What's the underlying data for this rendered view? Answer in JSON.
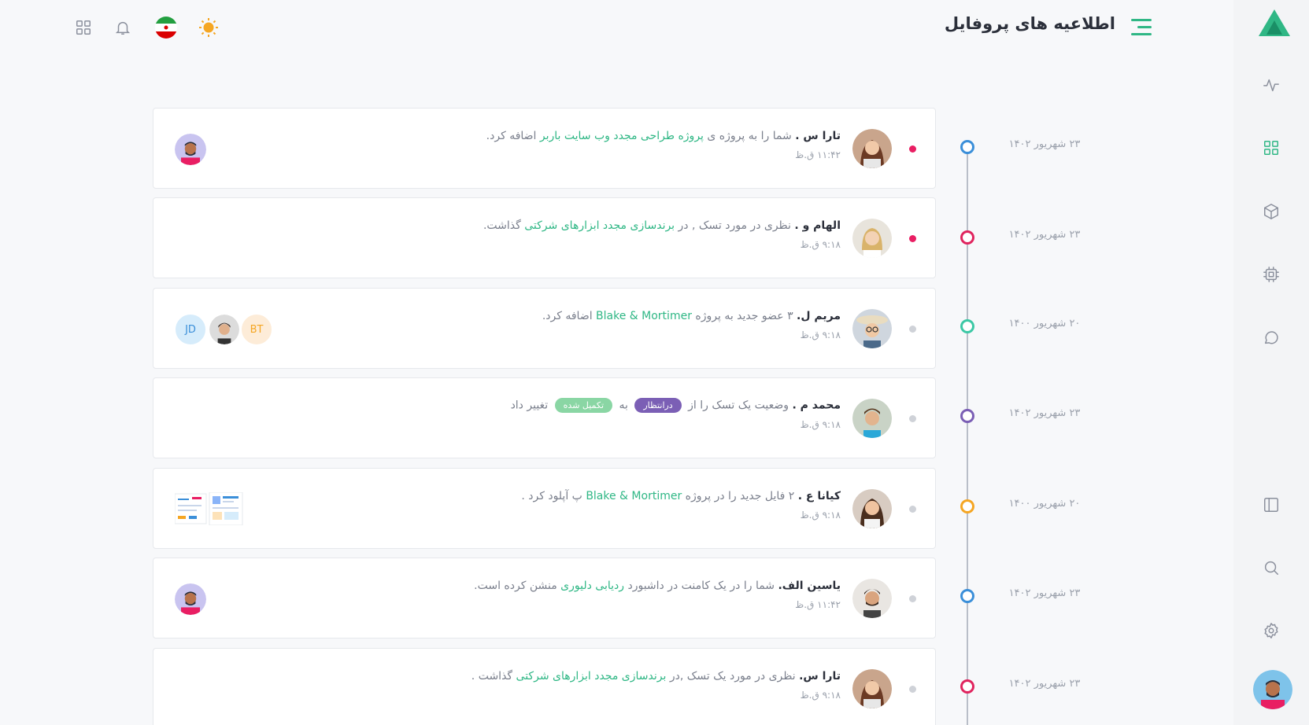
{
  "header": {
    "title": "اطلاعیه های پروفایل",
    "flag": "iran-flag-icon"
  },
  "colors": {
    "accent": "#2fb785",
    "unread": "#e91e63",
    "blue": "#3b8fd9",
    "red": "#e0245e",
    "teal": "#3cc8a5",
    "purple": "#7b5fb5",
    "orange": "#f5a623"
  },
  "sidebar": {
    "items": [
      {
        "icon": "activity-icon"
      },
      {
        "icon": "dashboard-grid-icon",
        "active": true
      },
      {
        "icon": "cube-icon"
      },
      {
        "icon": "cpu-chip-icon"
      },
      {
        "icon": "chat-bubble-icon"
      },
      {
        "icon": "layout-panel-icon"
      },
      {
        "icon": "search-icon"
      },
      {
        "icon": "settings-gear-icon"
      }
    ]
  },
  "timeline": [
    {
      "date": "۲۳ شهریور ۱۴۰۲",
      "dot_color": "#3b8fd9",
      "unread": true,
      "name": "تارا س .",
      "text_plain": " شما را به پروژه ی ",
      "text_link": "پروژه طراحی مجدد وب سایت باربر",
      "text_after": " اضافه کرد.",
      "time": "۱۱:۴۲ ق.ظ"
    },
    {
      "date": "۲۳ شهریور ۱۴۰۲",
      "dot_color": "#e0245e",
      "unread": true,
      "name": "الهام و .",
      "text_plain": " نظری در مورد تسک , در ",
      "text_link": "برندسازی مجدد ابزارهای شرکتی",
      "text_after": " گذاشت.",
      "time": "۹:۱۸ ق.ظ"
    },
    {
      "date": "۲۰ شهریور ۱۴۰۰",
      "dot_color": "#3cc8a5",
      "unread": false,
      "name": "مریم ل.",
      "text_plain": " ۳ عضو جدید به پروژه ",
      "text_link": "Blake & Mortimer",
      "text_after": " اضافه کرد.",
      "time": "۹:۱۸ ق.ظ",
      "initials": [
        "JD",
        "BT"
      ]
    },
    {
      "date": "۲۳ شهریور ۱۴۰۲",
      "dot_color": "#7b5fb5",
      "unread": false,
      "name": "محمد م .",
      "text_plain": " وضعیت یک تسک را از ",
      "badge_from": "درانتظار",
      "text_mid": " به ",
      "badge_to": "تکمیل شده",
      "text_after": " تغییر داد",
      "time": "۹:۱۸ ق.ظ"
    },
    {
      "date": "۲۰ شهریور ۱۴۰۰",
      "dot_color": "#f5a623",
      "unread": false,
      "name": "کیانا ع .",
      "text_plain": " ۲ فایل جدید را در پروژه ",
      "text_link": "Blake & Mortimer",
      "text_after": " پ آپلود کرد .",
      "time": "۹:۱۸ ق.ظ"
    },
    {
      "date": "۲۳ شهریور ۱۴۰۲",
      "dot_color": "#3b8fd9",
      "unread": false,
      "name": "یاسین الف.",
      "text_plain": " شما را در یک کامنت در داشبورد ",
      "text_link": "ردیابی دلیوری",
      "text_after": " منشن کرده است.",
      "time": "۱۱:۴۲ ق.ظ"
    },
    {
      "date": "۲۳ شهریور ۱۴۰۲",
      "dot_color": "#e0245e",
      "unread": false,
      "name": "تارا س.",
      "text_plain": " نظری در مورد یک تسک ,در ",
      "text_link": "برندسازی مجدد ابزارهای شرکتی",
      "text_after": " گذاشت .",
      "time": "۹:۱۸ ق.ظ"
    }
  ]
}
